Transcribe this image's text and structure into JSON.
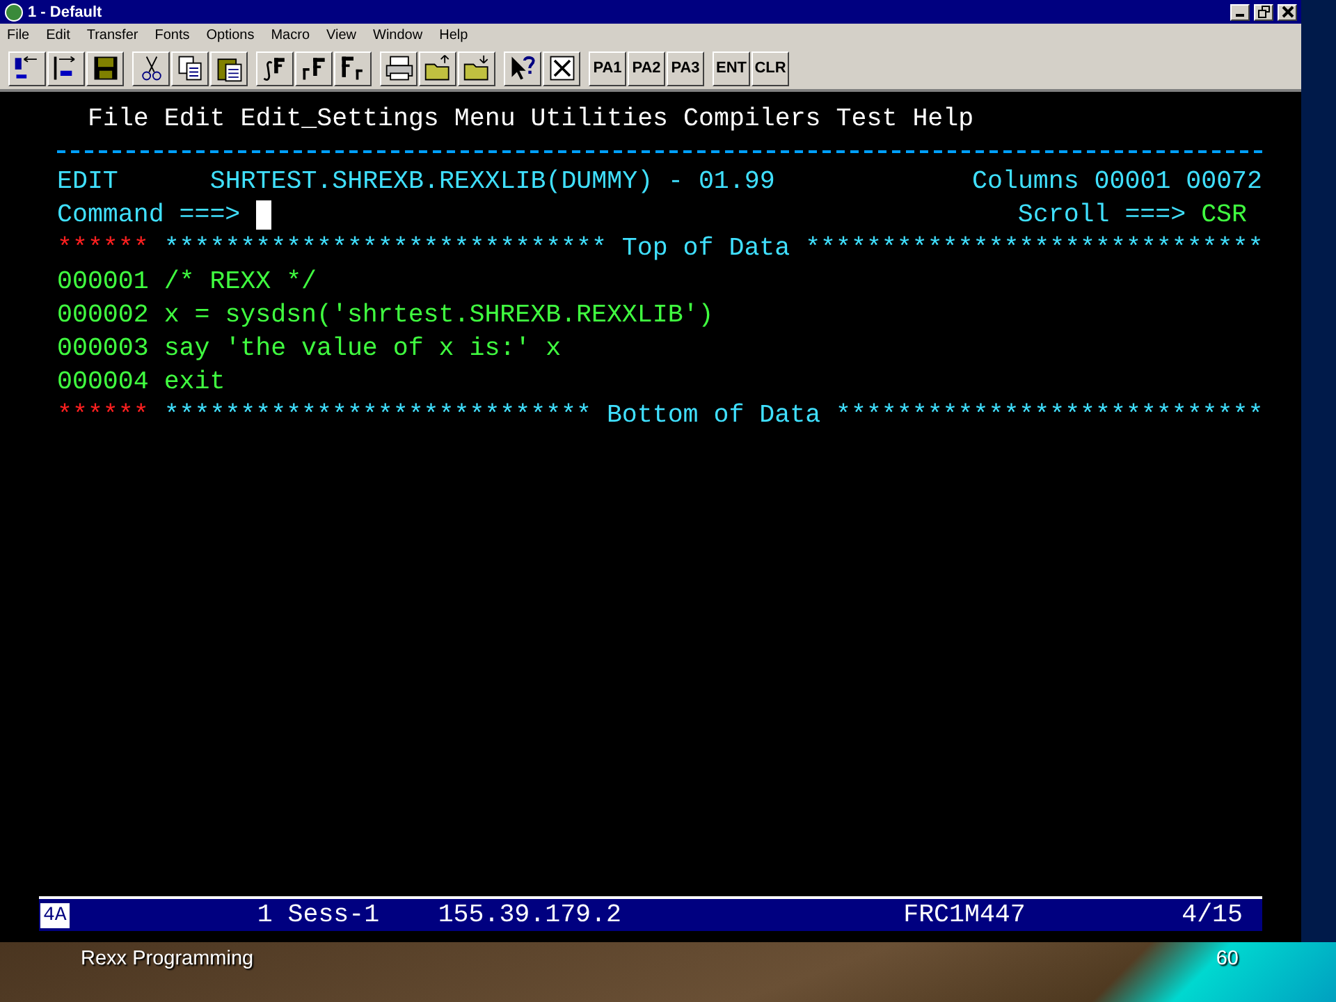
{
  "window": {
    "title": "1 - Default"
  },
  "menu_bar": [
    "File",
    "Edit",
    "Transfer",
    "Fonts",
    "Options",
    "Macro",
    "View",
    "Window",
    "Help"
  ],
  "toolbar_text_buttons": [
    "PA1",
    "PA2",
    "PA3",
    "ENT",
    "CLR"
  ],
  "terminal": {
    "menu": [
      "File",
      "Edit",
      "Edit_Settings",
      "Menu",
      "Utilities",
      "Compilers",
      "Test",
      "Help"
    ],
    "edit_header": {
      "mode": "EDIT",
      "dataset": "SHRTEST.SHREXB.REXXLIB(DUMMY) - 01.99",
      "columns": "Columns 00001 00072"
    },
    "command_line": {
      "label": "Command ===>",
      "scroll_label": "Scroll ===>",
      "scroll_value": "CSR"
    },
    "data_lines": [
      {
        "kind": "marker",
        "prefix": "******",
        "text": "***************************** Top of Data ******************************"
      },
      {
        "kind": "code",
        "prefix": "000001",
        "text": "/* REXX */"
      },
      {
        "kind": "code",
        "prefix": "000002",
        "text": "x = sysdsn('shrtest.SHREXB.REXXLIB')"
      },
      {
        "kind": "code",
        "prefix": "000003",
        "text": "say 'the value of x is:' x"
      },
      {
        "kind": "code",
        "prefix": "000004",
        "text": "exit"
      },
      {
        "kind": "marker",
        "prefix": "******",
        "text": "**************************** Bottom of Data ****************************"
      }
    ],
    "status_bar": {
      "indicator": "4A",
      "session": "1 Sess-1",
      "address": "155.39.179.2",
      "lu_name": "FRC1M447",
      "cursor": "4/15"
    }
  },
  "slide_footer": {
    "title": "Rexx Programming",
    "page": "60"
  }
}
